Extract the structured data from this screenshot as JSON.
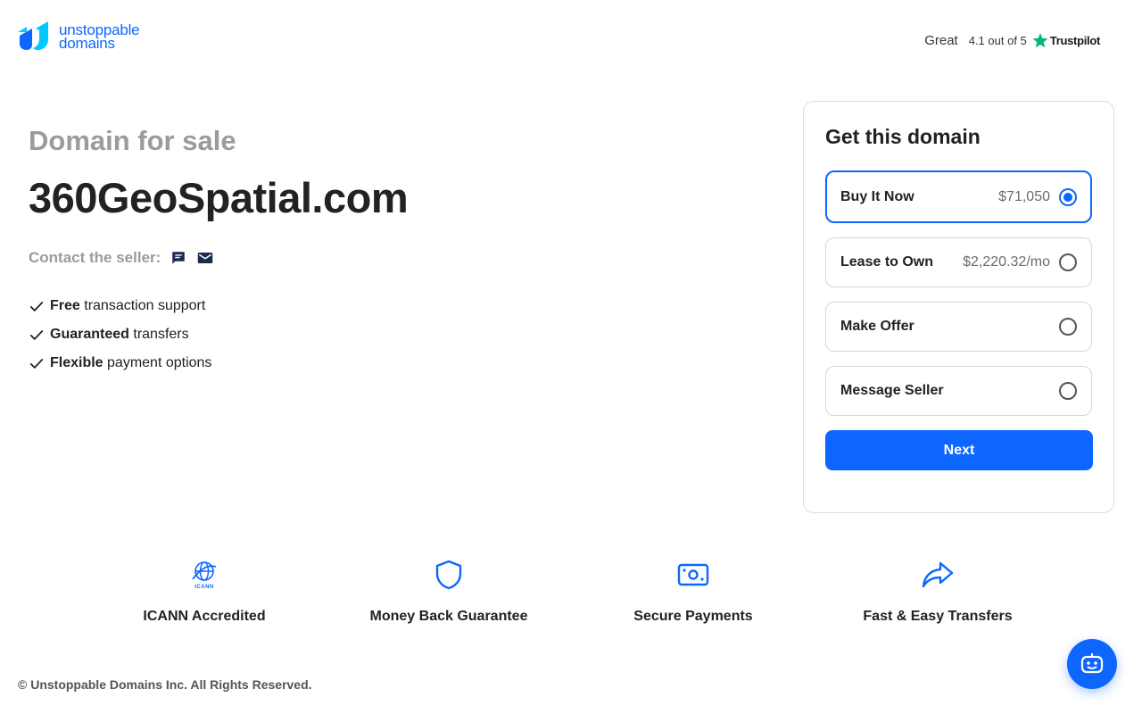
{
  "brand": {
    "line1": "unstoppable",
    "line2": "domains",
    "color": "#0d67fe"
  },
  "trustpilot": {
    "rating_word": "Great",
    "score_text": "4.1 out of 5",
    "brand": "Trustpilot",
    "star_color": "#00b67a"
  },
  "hero": {
    "eyebrow": "Domain for sale",
    "domain": "360GeoSpatial.com",
    "contact_label": "Contact the seller:",
    "contact_icons": [
      "chat-icon",
      "mail-icon"
    ],
    "features": [
      {
        "bold": "Free",
        "rest": " transaction support"
      },
      {
        "bold": "Guaranteed",
        "rest": " transfers"
      },
      {
        "bold": "Flexible",
        "rest": " payment options"
      }
    ]
  },
  "card": {
    "title": "Get this domain",
    "options": [
      {
        "label": "Buy It Now",
        "price": "$71,050",
        "selected": true
      },
      {
        "label": "Lease to Own",
        "price": "$2,220.32/mo",
        "selected": false
      },
      {
        "label": "Make Offer",
        "price": "",
        "selected": false
      },
      {
        "label": "Message Seller",
        "price": "",
        "selected": false
      }
    ],
    "next_label": "Next"
  },
  "badges": [
    {
      "label": "ICANN Accredited",
      "icon": "icann-globe-icon",
      "icon_text": "ICANN"
    },
    {
      "label": "Money Back Guarantee",
      "icon": "shield-icon"
    },
    {
      "label": "Secure Payments",
      "icon": "cash-icon"
    },
    {
      "label": "Fast & Easy Transfers",
      "icon": "share-arrow-icon"
    }
  ],
  "footer": {
    "copyright": "© Unstoppable Domains Inc. All Rights Reserved."
  },
  "colors": {
    "accent": "#0d67fe",
    "muted": "#9b9b9b",
    "text": "#222222"
  }
}
